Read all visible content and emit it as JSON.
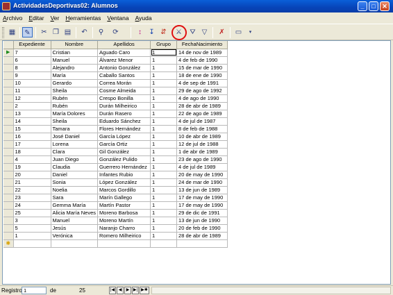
{
  "window": {
    "title": "ActividadesDeportivas02: Alumnos"
  },
  "window_controls": {
    "minimize": "_",
    "maximize": "□",
    "close": "✕"
  },
  "menu": [
    {
      "label": "Archivo",
      "underline": "A",
      "rest": "rchivo"
    },
    {
      "label": "Editar",
      "underline": "E",
      "rest": "ditar"
    },
    {
      "label": "Ver",
      "underline": "V",
      "rest": "er"
    },
    {
      "label": "Herramientas",
      "underline": "H",
      "rest": "erramientas"
    },
    {
      "label": "Ventana",
      "underline": "V",
      "rest": "entana"
    },
    {
      "label": "Ayuda",
      "underline": "A",
      "rest": "yuda"
    }
  ],
  "toolbar": {
    "buttons": [
      "view-icon",
      "design-icon",
      "cut-icon",
      "copy-icon",
      "paste-icon",
      "undo-icon",
      "find-icon",
      "sort-ascending-icon",
      "sort-descending-icon",
      "filter-by-selection-icon",
      "filter-by-form-icon",
      "apply-filter-icon",
      "remove-filter-icon",
      "new-record-icon",
      "delete-record-icon",
      "toolbar-options-icon"
    ],
    "highlight_color": "#e01010"
  },
  "table": {
    "columns": [
      "Expediente",
      "Nombre",
      "Apellidos",
      "Grupo",
      "FechaNacimiento"
    ],
    "rows": [
      [
        "7",
        "Cristian",
        "Aguado Caro",
        "1",
        "14 de nov de 1989"
      ],
      [
        "6",
        "Manuel",
        "Álvarez Menor",
        "1",
        "4 de feb de 1990"
      ],
      [
        "8",
        "Alejandro",
        "Antonio González",
        "1",
        "15 de mar de 1990"
      ],
      [
        "9",
        "María",
        "Caballo Santos",
        "1",
        "18 de ene de 1990"
      ],
      [
        "10",
        "Gerardo",
        "Correa Morán",
        "1",
        "4 de sep de 1991"
      ],
      [
        "11",
        "Sheila",
        "Cosme Almeida",
        "1",
        "29 de ago de 1992"
      ],
      [
        "12",
        "Rubén",
        "Crespo Bonilla",
        "1",
        "4 de ago de 1990"
      ],
      [
        "2",
        "Rubén",
        "Durán Milheirico",
        "1",
        "28 de abr de 1989"
      ],
      [
        "13",
        "María Dolores",
        "Durán Rasero",
        "1",
        "22 de ago de 1989"
      ],
      [
        "14",
        "Sheila",
        "Eduardo Sánchez",
        "1",
        "4 de jul de 1987"
      ],
      [
        "15",
        "Tamara",
        "Flores Hernández",
        "1",
        "8 de feb de 1988"
      ],
      [
        "16",
        "José Daniel",
        "García López",
        "1",
        "10 de abr de 1989"
      ],
      [
        "17",
        "Lorena",
        "García Ortiz",
        "1",
        "12 de jul de 1988"
      ],
      [
        "18",
        "Clara",
        "Gil González",
        "1",
        "1 de abr de 1989"
      ],
      [
        "4",
        "Juan Diego",
        "González Pulido",
        "1",
        "23 de ago de 1990"
      ],
      [
        "19",
        "Claudia",
        "Guerrero Hernández",
        "1",
        "4 de jul de 1989"
      ],
      [
        "20",
        "Daniel",
        "Infantes Rubio",
        "1",
        "20 de may de 1990"
      ],
      [
        "21",
        "Sonia",
        "López González",
        "1",
        "24 de mar de 1990"
      ],
      [
        "22",
        "Noelia",
        "Marcos Gordillo",
        "1",
        "13 de jun de 1989"
      ],
      [
        "23",
        "Sara",
        "Marín Gallego",
        "1",
        "17 de may de 1990"
      ],
      [
        "24",
        "Gemma María",
        "Martín Pastor",
        "1",
        "17 de may de 1990"
      ],
      [
        "25",
        "Alicia María Neves",
        "Moreno Barbosa",
        "1",
        "29 de dic de 1991"
      ],
      [
        "3",
        "Manuel",
        "Moreno Martín",
        "1",
        "13 de jun de 1990"
      ],
      [
        "5",
        "Jesús",
        "Naranjo Charro",
        "1",
        "20 de feb de 1990"
      ],
      [
        "1",
        "Verónica",
        "Romero Milheirico",
        "1",
        "28 de abr de 1989"
      ]
    ],
    "current_marker": "▶",
    "new_marker": "✱"
  },
  "navigator": {
    "label": "Registro",
    "current": "1",
    "of_label": "de",
    "total": "25",
    "buttons": [
      "|◀",
      "◀",
      "▶",
      "▶|",
      "▶✱"
    ]
  }
}
